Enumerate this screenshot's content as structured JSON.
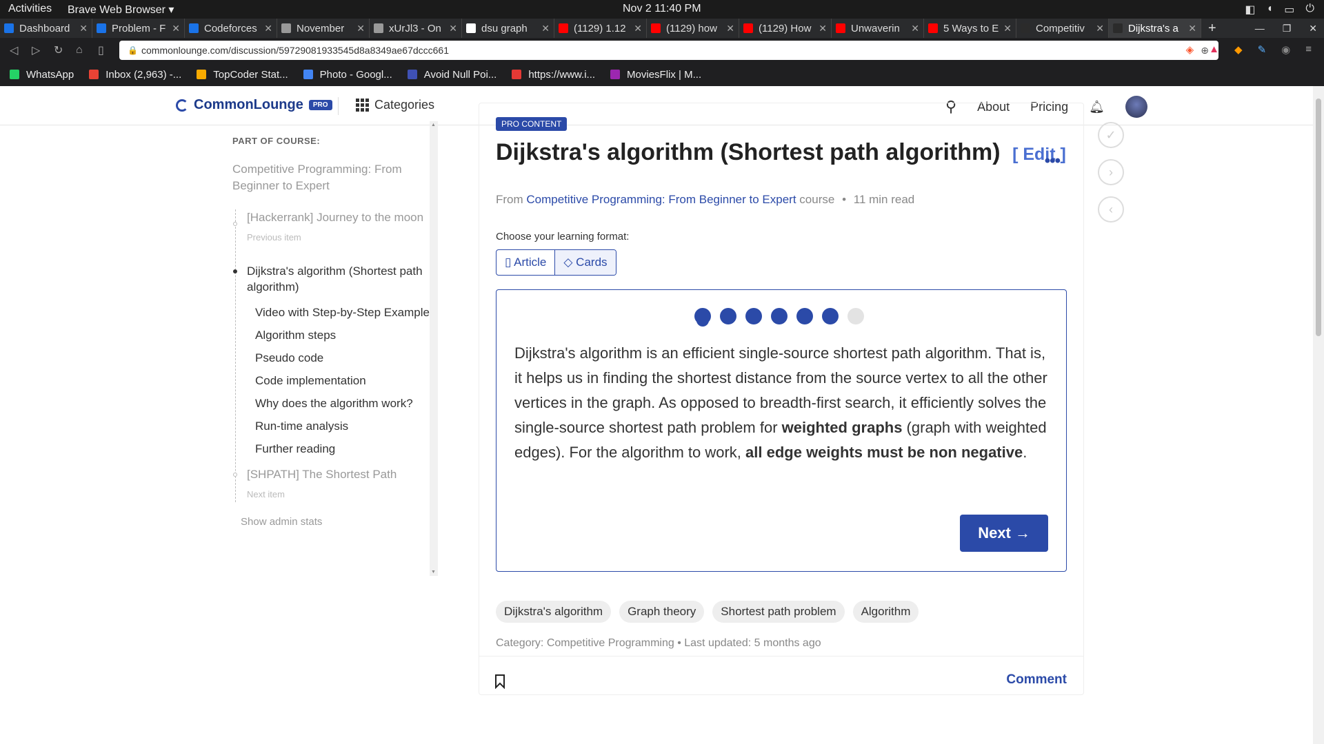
{
  "os": {
    "activities": "Activities",
    "app_name": "Brave Web Browser ▾",
    "clock": "Nov 2  11:40 PM"
  },
  "tabs": [
    {
      "title": "Dashboard",
      "color": "#1a73e8"
    },
    {
      "title": "Problem - F",
      "color": "#1a73e8"
    },
    {
      "title": "Codeforces",
      "color": "#1a73e8"
    },
    {
      "title": "November",
      "color": "#999999"
    },
    {
      "title": "xUrJl3 - On",
      "color": "#999999"
    },
    {
      "title": "dsu graph",
      "color": "#ffffff"
    },
    {
      "title": "(1129) 1.12",
      "color": "#ff0000"
    },
    {
      "title": "(1129) how",
      "color": "#ff0000"
    },
    {
      "title": "(1129) How",
      "color": "#ff0000"
    },
    {
      "title": "Unwaverin",
      "color": "#ff0000"
    },
    {
      "title": "5 Ways to E",
      "color": "#ff0000"
    },
    {
      "title": "Competitiv",
      "color": "#2b2b2b"
    },
    {
      "title": "Dijkstra's a",
      "color": "#2b2b2b"
    }
  ],
  "address_bar": {
    "url": "commonlounge.com/discussion/59729081933545d8a8349ae67dccc661"
  },
  "bookmarks": [
    {
      "label": "WhatsApp",
      "color": "#25d366"
    },
    {
      "label": "Inbox (2,963) -...",
      "color": "#ea4335"
    },
    {
      "label": "TopCoder Stat...",
      "color": "#f9ab00"
    },
    {
      "label": "Photo - Googl...",
      "color": "#4285f4"
    },
    {
      "label": "Avoid Null Poi...",
      "color": "#3f51b5"
    },
    {
      "label": "https://www.i...",
      "color": "#e53935"
    },
    {
      "label": "MoviesFlix | M...",
      "color": "#9c27b0"
    }
  ],
  "site_header": {
    "logo": "CommonLounge",
    "pro_badge": "PRO",
    "categories": "Categories",
    "about": "About",
    "pricing": "Pricing"
  },
  "sidebar": {
    "part_label": "PART OF COURSE:",
    "course": "Competitive Programming: From Beginner to Expert",
    "previous": {
      "title": "[Hackerrank] Journey to the moon",
      "note": "Previous item"
    },
    "current": "Dijkstra's algorithm (Shortest path algorithm)",
    "sections": [
      "Video with Step-by-Step Example",
      "Algorithm steps",
      "Pseudo code",
      "Code implementation",
      "Why does the algorithm work?",
      "Run-time analysis",
      "Further reading"
    ],
    "next": {
      "title": "[SHPATH] The Shortest Path",
      "note": "Next item"
    },
    "admin": "Show admin stats"
  },
  "article": {
    "badge": "PRO CONTENT",
    "title": "Dijkstra's algorithm (Shortest path algorithm)",
    "edit": "[ Edit ]",
    "from": "From",
    "course_link": "Competitive Programming: From Beginner to Expert",
    "course_word": "course",
    "read_time": "11 min read",
    "choose_format": "Choose your learning format:",
    "format_article": "Article",
    "format_cards": "Cards",
    "card_progress": {
      "total": 7,
      "completed": 6
    },
    "card_text": {
      "p1": "Dijkstra's algorithm is an efficient single-source shortest path algorithm. That is, it helps us in finding the shortest distance from the source vertex to all the other vertices in the graph. As opposed to breadth-first search, it efficiently solves the single-source shortest path problem for ",
      "b1": "weighted graphs",
      "p2": " (graph with weighted edges). For the algorithm to work, ",
      "b2": "all edge weights must be non negative",
      "p3": "."
    },
    "next_button": "Next →",
    "tags": [
      "Dijkstra's algorithm",
      "Graph theory",
      "Shortest path problem",
      "Algorithm"
    ],
    "category_line": "Category: Competitive Programming • Last updated: 5 months ago",
    "comment": "Comment"
  }
}
